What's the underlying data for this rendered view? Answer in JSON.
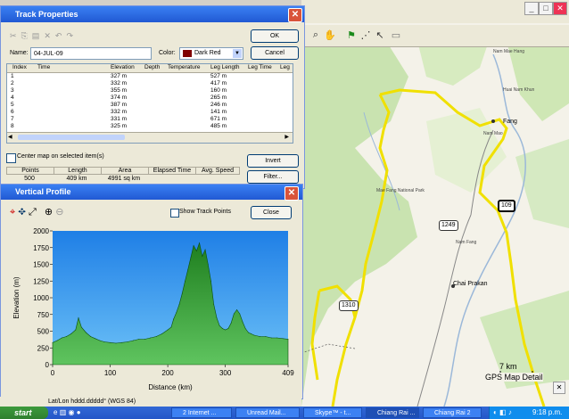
{
  "track_properties": {
    "title": "Track Properties",
    "name_label": "Name:",
    "name_value": "04-JUL-09",
    "color_label": "Color:",
    "color_value": "Dark Red",
    "color_swatch": "#800000",
    "ok_label": "OK",
    "cancel_label": "Cancel",
    "columns": [
      "Index",
      "Time",
      "Elevation",
      "Depth",
      "Temperature",
      "Leg Length",
      "Leg Time",
      "Leg"
    ],
    "rows": [
      {
        "index": "1",
        "elevation": "327 m",
        "leg_length": "527 m"
      },
      {
        "index": "2",
        "elevation": "332 m",
        "leg_length": "417 m"
      },
      {
        "index": "3",
        "elevation": "355 m",
        "leg_length": "160 m"
      },
      {
        "index": "4",
        "elevation": "374 m",
        "leg_length": "265 m"
      },
      {
        "index": "5",
        "elevation": "387 m",
        "leg_length": "246 m"
      },
      {
        "index": "6",
        "elevation": "332 m",
        "leg_length": "141 m"
      },
      {
        "index": "7",
        "elevation": "331 m",
        "leg_length": "671 m"
      },
      {
        "index": "8",
        "elevation": "325 m",
        "leg_length": "485 m"
      }
    ],
    "center_map_label": "Center map on selected item(s)",
    "invert_label": "Invert",
    "filter_label": "Filter...",
    "summary_headers": [
      "Points",
      "Length",
      "Area",
      "Elapsed Time",
      "Avg. Speed"
    ],
    "summary_values": [
      "500",
      "409 km",
      "4991 sq km",
      "",
      ""
    ]
  },
  "vertical_profile": {
    "title": "Vertical Profile",
    "show_track_points_label": "Show Track Points",
    "close_label": "Close",
    "tool_icons": [
      "select-icon",
      "pan-icon",
      "move-icon",
      "zoom-in-icon",
      "zoom-out-icon"
    ]
  },
  "chart_data": {
    "type": "area",
    "xlabel": "Distance  (km)",
    "ylabel": "Elevation  (m)",
    "xlim": [
      0,
      409
    ],
    "ylim": [
      0,
      2000
    ],
    "xticks": [
      0,
      100,
      200,
      300,
      409
    ],
    "yticks": [
      0,
      250,
      500,
      750,
      1000,
      1250,
      1500,
      1750,
      2000
    ],
    "x": [
      0,
      8,
      16,
      24,
      32,
      40,
      45,
      50,
      58,
      66,
      74,
      82,
      90,
      100,
      110,
      120,
      130,
      140,
      150,
      160,
      170,
      180,
      190,
      200,
      206,
      210,
      215,
      220,
      225,
      230,
      235,
      240,
      245,
      250,
      255,
      260,
      265,
      270,
      275,
      280,
      285,
      290,
      295,
      300,
      305,
      310,
      315,
      320,
      325,
      330,
      335,
      340,
      345,
      350,
      360,
      370,
      380,
      390,
      400,
      409
    ],
    "y": [
      330,
      360,
      400,
      420,
      460,
      520,
      700,
      560,
      480,
      420,
      390,
      360,
      340,
      330,
      320,
      330,
      340,
      360,
      380,
      380,
      400,
      420,
      460,
      520,
      560,
      680,
      780,
      900,
      1060,
      1250,
      1420,
      1600,
      1780,
      1700,
      1820,
      1620,
      1720,
      1500,
      1250,
      900,
      700,
      580,
      540,
      520,
      540,
      620,
      760,
      820,
      760,
      640,
      540,
      480,
      460,
      440,
      420,
      420,
      400,
      400,
      390,
      380
    ],
    "fill_color_top": "#1f8a1f",
    "fill_color_bottom": "#5fc45f",
    "background_color": "#39a0f0"
  },
  "map": {
    "labels": [
      "Nam Mae Hang",
      "Huai Nam Khun",
      "Fang",
      "Nam Mao",
      "Mae Fang National Park",
      "Nam Fang",
      "Chai Prakan"
    ],
    "road_tags": [
      "1249",
      "109",
      "1310"
    ],
    "scale_label": "7 km",
    "provider_label": "GPS Map Detail",
    "track_color": "#f0e000"
  },
  "status_bar": {
    "text": "Lat/Lon hddd.ddddd° (WGS 84)"
  },
  "taskbar": {
    "start_label": "start",
    "tasks": [
      "2 Internet ...",
      "Unread Mail...",
      "Skype™ - t...",
      "Chiang Rai ...",
      "Chiang Rai 2"
    ],
    "clock": "9:18 p.m."
  }
}
